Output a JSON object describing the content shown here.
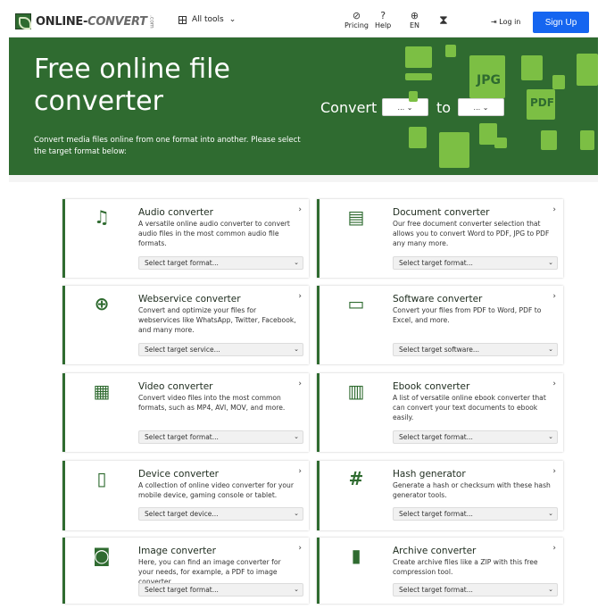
{
  "nav": {
    "logo_main": "ONLINE-",
    "logo_conv": "CONVERT",
    "logo_com": ".com",
    "all_tools": "All tools",
    "pricing": "Pricing",
    "help": "Help",
    "language": "EN",
    "login": "Log in",
    "signup": "Sign Up"
  },
  "hero": {
    "title": "Free online file converter",
    "subtitle": "Convert media files online from one format into another. Please select the target format below:",
    "convert_label": "Convert",
    "to_label": "to",
    "from_value": "...",
    "to_value": "...",
    "decor_labels": [
      "JPG",
      "PDF"
    ]
  },
  "colors": {
    "brand_green": "#2f6b30",
    "accent_green": "#7cbf44",
    "signup_blue": "#1565f0"
  },
  "cards": [
    {
      "icon": "music-note-icon",
      "glyph": "♫",
      "title": "Audio converter",
      "desc": "A versatile online audio converter to convert audio files in the most common audio file formats.",
      "select": "Select target format..."
    },
    {
      "icon": "document-icon",
      "glyph": "▤",
      "title": "Document converter",
      "desc": "Our free document converter selection that allows you to convert Word to PDF, JPG to PDF any many more.",
      "select": "Select target format..."
    },
    {
      "icon": "globe-icon",
      "glyph": "⊕",
      "title": "Webservice converter",
      "desc": "Convert and optimize your files for webservices like WhatsApp, Twitter, Facebook, and many more.",
      "select": "Select target service..."
    },
    {
      "icon": "monitor-icon",
      "glyph": "▭",
      "title": "Software converter",
      "desc": "Convert your files from PDF to Word, PDF to Excel, and more.",
      "select": "Select target software..."
    },
    {
      "icon": "film-icon",
      "glyph": "▦",
      "title": "Video converter",
      "desc": "Convert video files into the most common formats, such as MP4, AVI, MOV, and more.",
      "select": "Select target format..."
    },
    {
      "icon": "books-icon",
      "glyph": "▥",
      "title": "Ebook converter",
      "desc": "A list of versatile online ebook converter that can convert your text documents to ebook easily.",
      "select": "Select target format..."
    },
    {
      "icon": "tablet-icon",
      "glyph": "▯",
      "title": "Device converter",
      "desc": "A collection of online video converter for your mobile device, gaming console or tablet.",
      "select": "Select target device..."
    },
    {
      "icon": "hash-icon",
      "glyph": "#",
      "title": "Hash generator",
      "desc": "Generate a hash or checksum with these hash generator tools.",
      "select": "Select target format..."
    },
    {
      "icon": "camera-icon",
      "glyph": "◙",
      "title": "Image converter",
      "desc": "Here, you can find an image converter for your needs, for example, a PDF to image converter.",
      "select": "Select target format..."
    },
    {
      "icon": "archive-icon",
      "glyph": "▮",
      "title": "Archive converter",
      "desc": "Create archive files like a ZIP with this free compression tool.",
      "select": "Select target format..."
    }
  ]
}
